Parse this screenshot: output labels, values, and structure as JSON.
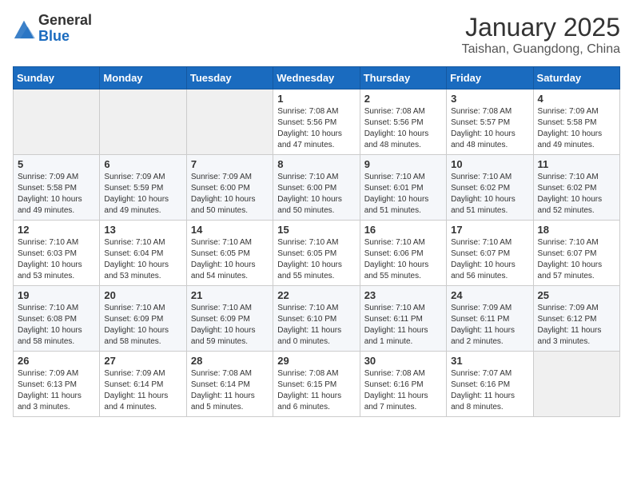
{
  "header": {
    "logo_general": "General",
    "logo_blue": "Blue",
    "month_title": "January 2025",
    "location": "Taishan, Guangdong, China"
  },
  "weekdays": [
    "Sunday",
    "Monday",
    "Tuesday",
    "Wednesday",
    "Thursday",
    "Friday",
    "Saturday"
  ],
  "weeks": [
    [
      {
        "day": "",
        "info": ""
      },
      {
        "day": "",
        "info": ""
      },
      {
        "day": "",
        "info": ""
      },
      {
        "day": "1",
        "info": "Sunrise: 7:08 AM\nSunset: 5:56 PM\nDaylight: 10 hours\nand 47 minutes."
      },
      {
        "day": "2",
        "info": "Sunrise: 7:08 AM\nSunset: 5:56 PM\nDaylight: 10 hours\nand 48 minutes."
      },
      {
        "day": "3",
        "info": "Sunrise: 7:08 AM\nSunset: 5:57 PM\nDaylight: 10 hours\nand 48 minutes."
      },
      {
        "day": "4",
        "info": "Sunrise: 7:09 AM\nSunset: 5:58 PM\nDaylight: 10 hours\nand 49 minutes."
      }
    ],
    [
      {
        "day": "5",
        "info": "Sunrise: 7:09 AM\nSunset: 5:58 PM\nDaylight: 10 hours\nand 49 minutes."
      },
      {
        "day": "6",
        "info": "Sunrise: 7:09 AM\nSunset: 5:59 PM\nDaylight: 10 hours\nand 49 minutes."
      },
      {
        "day": "7",
        "info": "Sunrise: 7:09 AM\nSunset: 6:00 PM\nDaylight: 10 hours\nand 50 minutes."
      },
      {
        "day": "8",
        "info": "Sunrise: 7:10 AM\nSunset: 6:00 PM\nDaylight: 10 hours\nand 50 minutes."
      },
      {
        "day": "9",
        "info": "Sunrise: 7:10 AM\nSunset: 6:01 PM\nDaylight: 10 hours\nand 51 minutes."
      },
      {
        "day": "10",
        "info": "Sunrise: 7:10 AM\nSunset: 6:02 PM\nDaylight: 10 hours\nand 51 minutes."
      },
      {
        "day": "11",
        "info": "Sunrise: 7:10 AM\nSunset: 6:02 PM\nDaylight: 10 hours\nand 52 minutes."
      }
    ],
    [
      {
        "day": "12",
        "info": "Sunrise: 7:10 AM\nSunset: 6:03 PM\nDaylight: 10 hours\nand 53 minutes."
      },
      {
        "day": "13",
        "info": "Sunrise: 7:10 AM\nSunset: 6:04 PM\nDaylight: 10 hours\nand 53 minutes."
      },
      {
        "day": "14",
        "info": "Sunrise: 7:10 AM\nSunset: 6:05 PM\nDaylight: 10 hours\nand 54 minutes."
      },
      {
        "day": "15",
        "info": "Sunrise: 7:10 AM\nSunset: 6:05 PM\nDaylight: 10 hours\nand 55 minutes."
      },
      {
        "day": "16",
        "info": "Sunrise: 7:10 AM\nSunset: 6:06 PM\nDaylight: 10 hours\nand 55 minutes."
      },
      {
        "day": "17",
        "info": "Sunrise: 7:10 AM\nSunset: 6:07 PM\nDaylight: 10 hours\nand 56 minutes."
      },
      {
        "day": "18",
        "info": "Sunrise: 7:10 AM\nSunset: 6:07 PM\nDaylight: 10 hours\nand 57 minutes."
      }
    ],
    [
      {
        "day": "19",
        "info": "Sunrise: 7:10 AM\nSunset: 6:08 PM\nDaylight: 10 hours\nand 58 minutes."
      },
      {
        "day": "20",
        "info": "Sunrise: 7:10 AM\nSunset: 6:09 PM\nDaylight: 10 hours\nand 58 minutes."
      },
      {
        "day": "21",
        "info": "Sunrise: 7:10 AM\nSunset: 6:09 PM\nDaylight: 10 hours\nand 59 minutes."
      },
      {
        "day": "22",
        "info": "Sunrise: 7:10 AM\nSunset: 6:10 PM\nDaylight: 11 hours\nand 0 minutes."
      },
      {
        "day": "23",
        "info": "Sunrise: 7:10 AM\nSunset: 6:11 PM\nDaylight: 11 hours\nand 1 minute."
      },
      {
        "day": "24",
        "info": "Sunrise: 7:09 AM\nSunset: 6:11 PM\nDaylight: 11 hours\nand 2 minutes."
      },
      {
        "day": "25",
        "info": "Sunrise: 7:09 AM\nSunset: 6:12 PM\nDaylight: 11 hours\nand 3 minutes."
      }
    ],
    [
      {
        "day": "26",
        "info": "Sunrise: 7:09 AM\nSunset: 6:13 PM\nDaylight: 11 hours\nand 3 minutes."
      },
      {
        "day": "27",
        "info": "Sunrise: 7:09 AM\nSunset: 6:14 PM\nDaylight: 11 hours\nand 4 minutes."
      },
      {
        "day": "28",
        "info": "Sunrise: 7:08 AM\nSunset: 6:14 PM\nDaylight: 11 hours\nand 5 minutes."
      },
      {
        "day": "29",
        "info": "Sunrise: 7:08 AM\nSunset: 6:15 PM\nDaylight: 11 hours\nand 6 minutes."
      },
      {
        "day": "30",
        "info": "Sunrise: 7:08 AM\nSunset: 6:16 PM\nDaylight: 11 hours\nand 7 minutes."
      },
      {
        "day": "31",
        "info": "Sunrise: 7:07 AM\nSunset: 6:16 PM\nDaylight: 11 hours\nand 8 minutes."
      },
      {
        "day": "",
        "info": ""
      }
    ]
  ]
}
